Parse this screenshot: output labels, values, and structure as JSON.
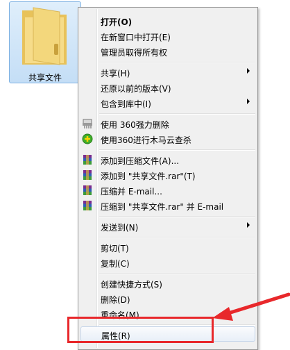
{
  "desktop": {
    "folder_label": "共享文件"
  },
  "colors": {
    "highlight": "#e8282b",
    "menu_background": "#f0f0f0"
  },
  "menu": {
    "items": [
      {
        "label": "打开(O)",
        "icon": "none"
      },
      {
        "label": "在新窗口中打开(E)",
        "icon": "none"
      },
      {
        "label": "管理员取得所有权",
        "icon": "none"
      },
      {
        "label": "共享(H)",
        "icon": "none",
        "submenu": true
      },
      {
        "label": "还原以前的版本(V)",
        "icon": "none"
      },
      {
        "label": "包含到库中(I)",
        "icon": "none",
        "submenu": true
      },
      {
        "label": "使用 360强力删除",
        "icon": "shredder-icon"
      },
      {
        "label": "使用360进行木马云查杀",
        "icon": "360-scan-icon"
      },
      {
        "label": "添加到压缩文件(A)...",
        "icon": "winrar-icon"
      },
      {
        "label": "添加到 \"共享文件.rar\"(T)",
        "icon": "winrar-icon"
      },
      {
        "label": "压缩并 E-mail...",
        "icon": "winrar-icon"
      },
      {
        "label": "压缩到 \"共享文件.rar\" 并 E-mail",
        "icon": "winrar-icon"
      },
      {
        "label": "发送到(N)",
        "icon": "none",
        "submenu": true
      },
      {
        "label": "剪切(T)",
        "icon": "none"
      },
      {
        "label": "复制(C)",
        "icon": "none"
      },
      {
        "label": "创建快捷方式(S)",
        "icon": "none"
      },
      {
        "label": "删除(D)",
        "icon": "none"
      },
      {
        "label": "重命名(M)",
        "icon": "none"
      },
      {
        "label": "属性(R)",
        "icon": "none"
      }
    ]
  }
}
